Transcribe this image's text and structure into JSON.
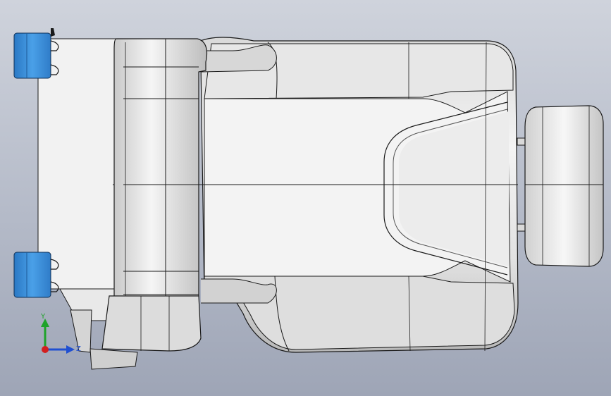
{
  "viewport": {
    "background_top": "#cfd3dc",
    "background_bottom": "#9ea5b6",
    "model_color": "#e6e6e6",
    "edge_color": "#1a1a1a",
    "highlight_color": "#3d8fd6"
  },
  "triad": {
    "y_label": "Y",
    "z_label": "Z",
    "y_color": "#1fa32a",
    "z_color": "#1f4fd1",
    "x_color": "#d21f1f"
  }
}
